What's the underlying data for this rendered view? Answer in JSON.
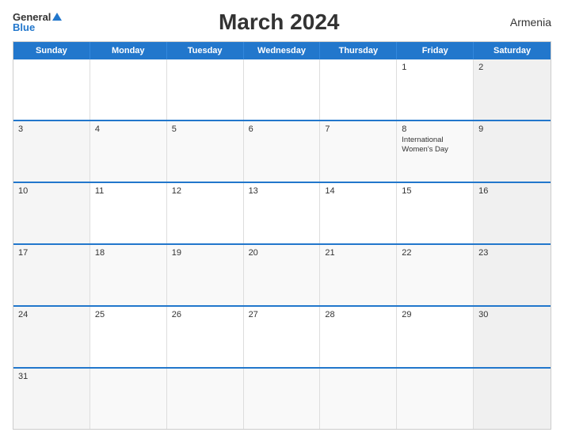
{
  "header": {
    "title": "March 2024",
    "country": "Armenia",
    "logo": {
      "general": "General",
      "blue": "Blue"
    }
  },
  "days": {
    "headers": [
      "Sunday",
      "Monday",
      "Tuesday",
      "Wednesday",
      "Thursday",
      "Friday",
      "Saturday"
    ]
  },
  "weeks": [
    {
      "cells": [
        {
          "day": "",
          "empty": true,
          "weekend": false
        },
        {
          "day": "",
          "empty": true,
          "weekend": false
        },
        {
          "day": "",
          "empty": true,
          "weekend": false
        },
        {
          "day": "",
          "empty": true,
          "weekend": false
        },
        {
          "day": "",
          "empty": true,
          "weekend": false
        },
        {
          "day": "1",
          "empty": false,
          "weekend": false
        },
        {
          "day": "2",
          "empty": false,
          "weekend": true,
          "saturday": true
        }
      ]
    },
    {
      "cells": [
        {
          "day": "3",
          "empty": false,
          "weekend": true
        },
        {
          "day": "4",
          "empty": false,
          "weekend": false
        },
        {
          "day": "5",
          "empty": false,
          "weekend": false
        },
        {
          "day": "6",
          "empty": false,
          "weekend": false
        },
        {
          "day": "7",
          "empty": false,
          "weekend": false
        },
        {
          "day": "8",
          "empty": false,
          "weekend": false,
          "event": "International Women's Day"
        },
        {
          "day": "9",
          "empty": false,
          "weekend": true,
          "saturday": true
        }
      ]
    },
    {
      "cells": [
        {
          "day": "10",
          "empty": false,
          "weekend": true
        },
        {
          "day": "11",
          "empty": false,
          "weekend": false
        },
        {
          "day": "12",
          "empty": false,
          "weekend": false
        },
        {
          "day": "13",
          "empty": false,
          "weekend": false
        },
        {
          "day": "14",
          "empty": false,
          "weekend": false
        },
        {
          "day": "15",
          "empty": false,
          "weekend": false
        },
        {
          "day": "16",
          "empty": false,
          "weekend": true,
          "saturday": true
        }
      ]
    },
    {
      "cells": [
        {
          "day": "17",
          "empty": false,
          "weekend": true
        },
        {
          "day": "18",
          "empty": false,
          "weekend": false
        },
        {
          "day": "19",
          "empty": false,
          "weekend": false
        },
        {
          "day": "20",
          "empty": false,
          "weekend": false
        },
        {
          "day": "21",
          "empty": false,
          "weekend": false
        },
        {
          "day": "22",
          "empty": false,
          "weekend": false
        },
        {
          "day": "23",
          "empty": false,
          "weekend": true,
          "saturday": true
        }
      ]
    },
    {
      "cells": [
        {
          "day": "24",
          "empty": false,
          "weekend": true
        },
        {
          "day": "25",
          "empty": false,
          "weekend": false
        },
        {
          "day": "26",
          "empty": false,
          "weekend": false
        },
        {
          "day": "27",
          "empty": false,
          "weekend": false
        },
        {
          "day": "28",
          "empty": false,
          "weekend": false
        },
        {
          "day": "29",
          "empty": false,
          "weekend": false
        },
        {
          "day": "30",
          "empty": false,
          "weekend": true,
          "saturday": true
        }
      ]
    },
    {
      "cells": [
        {
          "day": "31",
          "empty": false,
          "weekend": true
        },
        {
          "day": "",
          "empty": true,
          "weekend": false
        },
        {
          "day": "",
          "empty": true,
          "weekend": false
        },
        {
          "day": "",
          "empty": true,
          "weekend": false
        },
        {
          "day": "",
          "empty": true,
          "weekend": false
        },
        {
          "day": "",
          "empty": true,
          "weekend": false
        },
        {
          "day": "",
          "empty": true,
          "weekend": true,
          "saturday": true
        }
      ]
    }
  ]
}
